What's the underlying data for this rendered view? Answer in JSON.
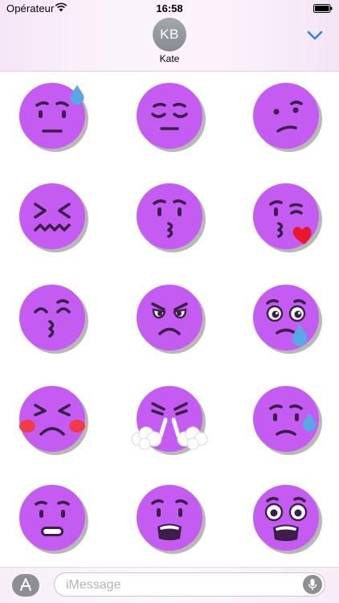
{
  "status_bar": {
    "carrier": "Opérateur",
    "time": "16:58"
  },
  "header": {
    "avatar_initials": "KB",
    "contact_name": "Kate",
    "accent_color": "#2f7ff6"
  },
  "stickers": [
    {
      "name": "anxious-sweat-face",
      "icon": "anxious-face-with-sweat"
    },
    {
      "name": "relieved-face",
      "icon": "relieved-face"
    },
    {
      "name": "confused-face",
      "icon": "confused-face"
    },
    {
      "name": "confounded-face",
      "icon": "confounded-face"
    },
    {
      "name": "kissing-face",
      "icon": "kissing-face"
    },
    {
      "name": "kissing-heart-face",
      "icon": "face-blowing-a-kiss"
    },
    {
      "name": "kissing-smiling-eyes-face",
      "icon": "kissing-face-with-smiling-eyes"
    },
    {
      "name": "angry-face",
      "icon": "angry-face"
    },
    {
      "name": "sad-tear-face",
      "icon": "sad-but-relieved-face"
    },
    {
      "name": "tired-blush-face",
      "icon": "tired-face"
    },
    {
      "name": "triumph-steam-face",
      "icon": "face-with-steam-from-nose"
    },
    {
      "name": "disappointed-sweat-face",
      "icon": "disappointed-but-relieved-face"
    },
    {
      "name": "grimacing-face",
      "icon": "grimacing-face"
    },
    {
      "name": "anguished-face",
      "icon": "anguished-face"
    },
    {
      "name": "fearful-face",
      "icon": "fearful-face"
    }
  ],
  "colors": {
    "face": "#c45cf1",
    "feature": "#3b1f4a",
    "tear": "#5aa7e6",
    "heart": "#e8182a",
    "blush": "#f23a4a"
  },
  "composer": {
    "placeholder": "iMessage"
  }
}
